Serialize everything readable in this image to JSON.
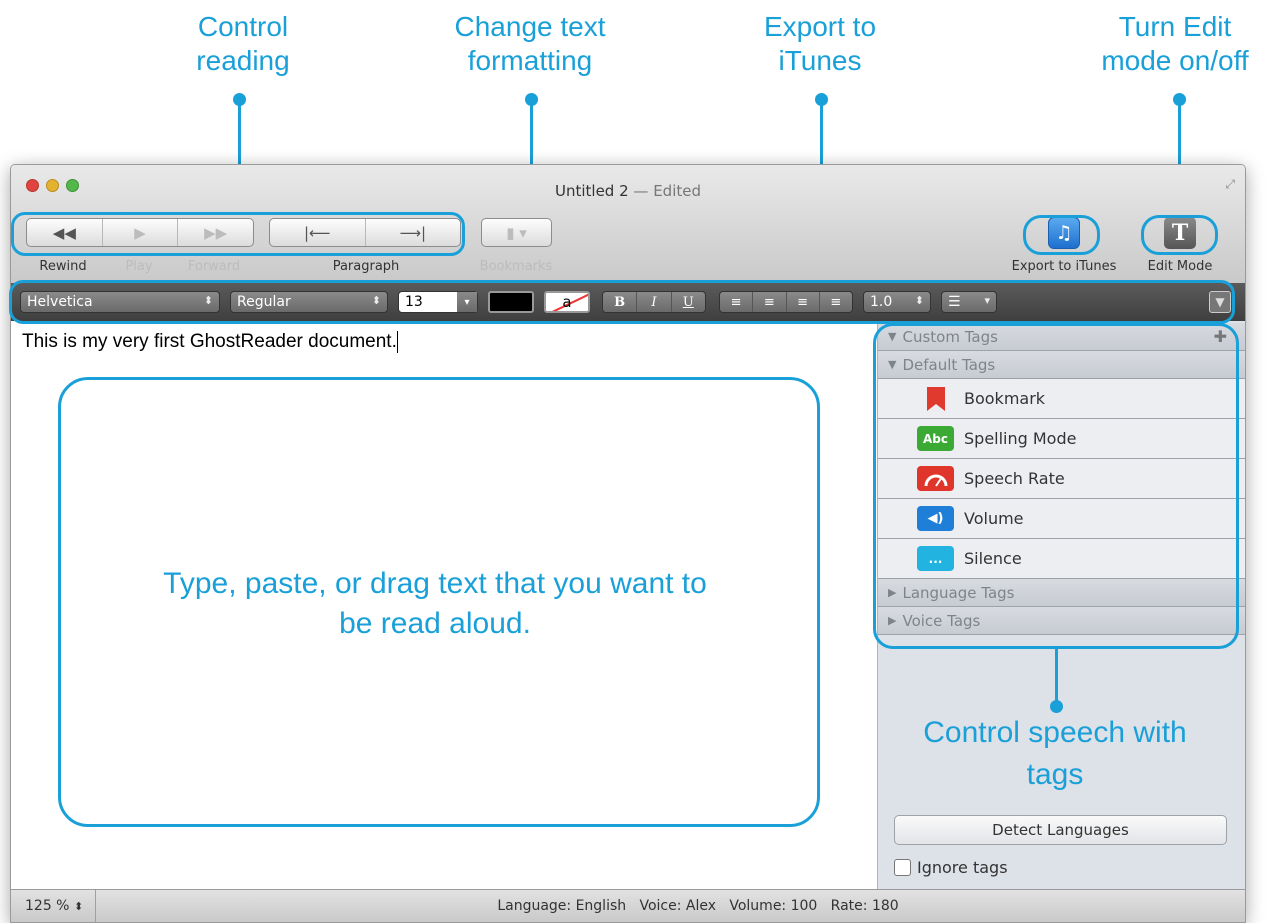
{
  "callouts": {
    "control_reading": "Control reading",
    "change_formatting": "Change text formatting",
    "export_itunes": "Export to iTunes",
    "edit_mode": "Turn Edit mode on/off",
    "placeholder": "Type, paste, or drag text that you want to be read aloud.",
    "control_speech": "Control speech with tags"
  },
  "window": {
    "title": "Untitled 2",
    "title_status": "— Edited"
  },
  "toolbar": {
    "rewind_label": "Rewind",
    "play_label": "Play",
    "forward_label": "Forward",
    "paragraph_label": "Paragraph",
    "bookmarks_label": "Bookmarks",
    "export_label": "Export to iTunes",
    "edit_mode_label": "Edit Mode"
  },
  "format": {
    "font_family": "Helvetica",
    "font_style": "Regular",
    "font_size": "13",
    "bg_swatch_letter": "a",
    "bold": "B",
    "italic": "I",
    "underline": "U",
    "line_spacing": "1.0"
  },
  "editor": {
    "text": "This is my very first GhostReader document."
  },
  "sidebar": {
    "custom_tags": "Custom Tags",
    "default_tags": "Default Tags",
    "items": [
      {
        "label": "Bookmark",
        "icon": "bookmark-icon",
        "color": "#e03a2e"
      },
      {
        "label": "Spelling Mode",
        "icon": "abc-icon",
        "icon_text": "Abc",
        "color": "#3aaa35"
      },
      {
        "label": "Speech Rate",
        "icon": "speedometer-icon",
        "color": "#e0352b"
      },
      {
        "label": "Volume",
        "icon": "speaker-icon",
        "color": "#1f7fd8"
      },
      {
        "label": "Silence",
        "icon": "ellipsis-icon",
        "icon_text": "...",
        "color": "#22b3e0"
      }
    ],
    "language_tags": "Language Tags",
    "voice_tags": "Voice Tags",
    "detect_button": "Detect Languages",
    "ignore_tags": "Ignore tags"
  },
  "status": {
    "zoom": "125 %",
    "info": "Language: English   Voice: Alex   Volume: 100   Rate: 180"
  },
  "colors": {
    "accent": "#1aa0d8"
  }
}
